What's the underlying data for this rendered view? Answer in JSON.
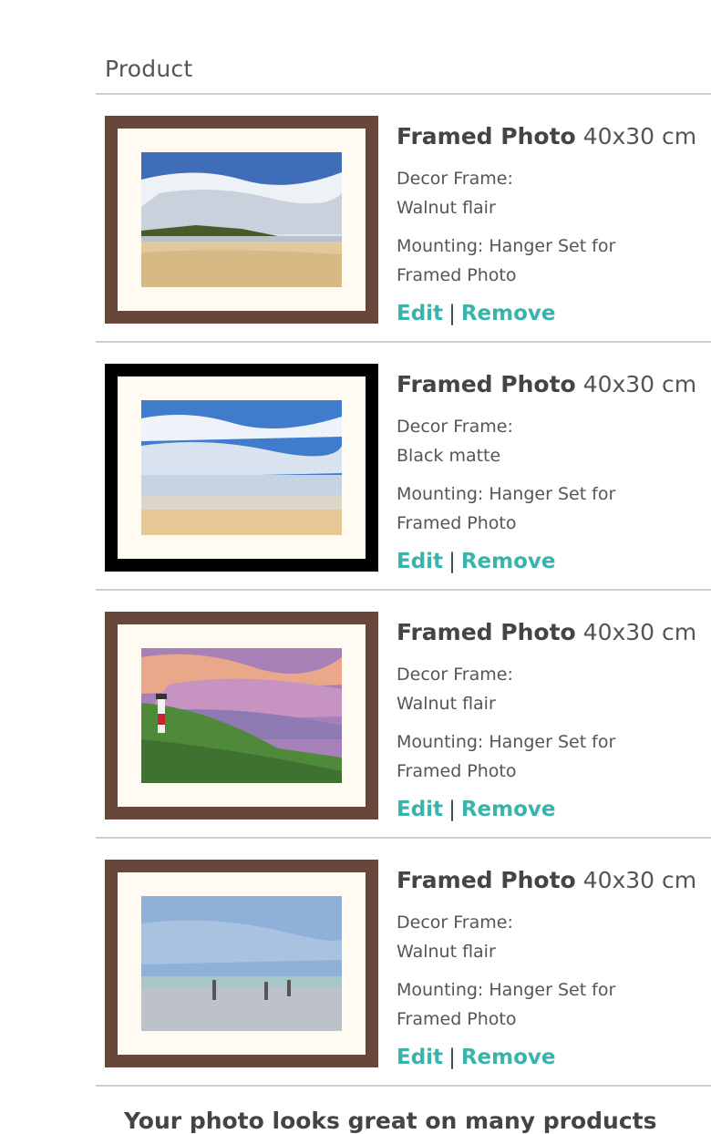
{
  "table": {
    "column_header": "Product"
  },
  "items": [
    {
      "title": "Framed Photo",
      "size": "40x30 cm",
      "frame_label": "Decor Frame:",
      "frame_value": "Walnut flair",
      "mounting_line1": "Mounting: Hanger Set for",
      "mounting_line2": "Framed Photo",
      "edit_label": "Edit",
      "separator": "|",
      "remove_label": "Remove",
      "frame_color": "#67473a"
    },
    {
      "title": "Framed Photo",
      "size": "40x30 cm",
      "frame_label": "Decor Frame:",
      "frame_value": "Black matte",
      "mounting_line1": "Mounting: Hanger Set for",
      "mounting_line2": "Framed Photo",
      "edit_label": "Edit",
      "separator": "|",
      "remove_label": "Remove",
      "frame_color": "#000000"
    },
    {
      "title": "Framed Photo",
      "size": "40x30 cm",
      "frame_label": "Decor Frame:",
      "frame_value": "Walnut flair",
      "mounting_line1": "Mounting: Hanger Set for",
      "mounting_line2": "Framed Photo",
      "edit_label": "Edit",
      "separator": "|",
      "remove_label": "Remove",
      "frame_color": "#67473a"
    },
    {
      "title": "Framed Photo",
      "size": "40x30 cm",
      "frame_label": "Decor Frame:",
      "frame_value": "Walnut flair",
      "mounting_line1": "Mounting: Hanger Set for",
      "mounting_line2": "Framed Photo",
      "edit_label": "Edit",
      "separator": "|",
      "remove_label": "Remove",
      "frame_color": "#67473a"
    }
  ],
  "promo": {
    "text": "Your photo looks great on many products"
  },
  "colors": {
    "link": "#3bb3ad",
    "divider": "#cfcfcf",
    "mat": "#fffaf2"
  }
}
